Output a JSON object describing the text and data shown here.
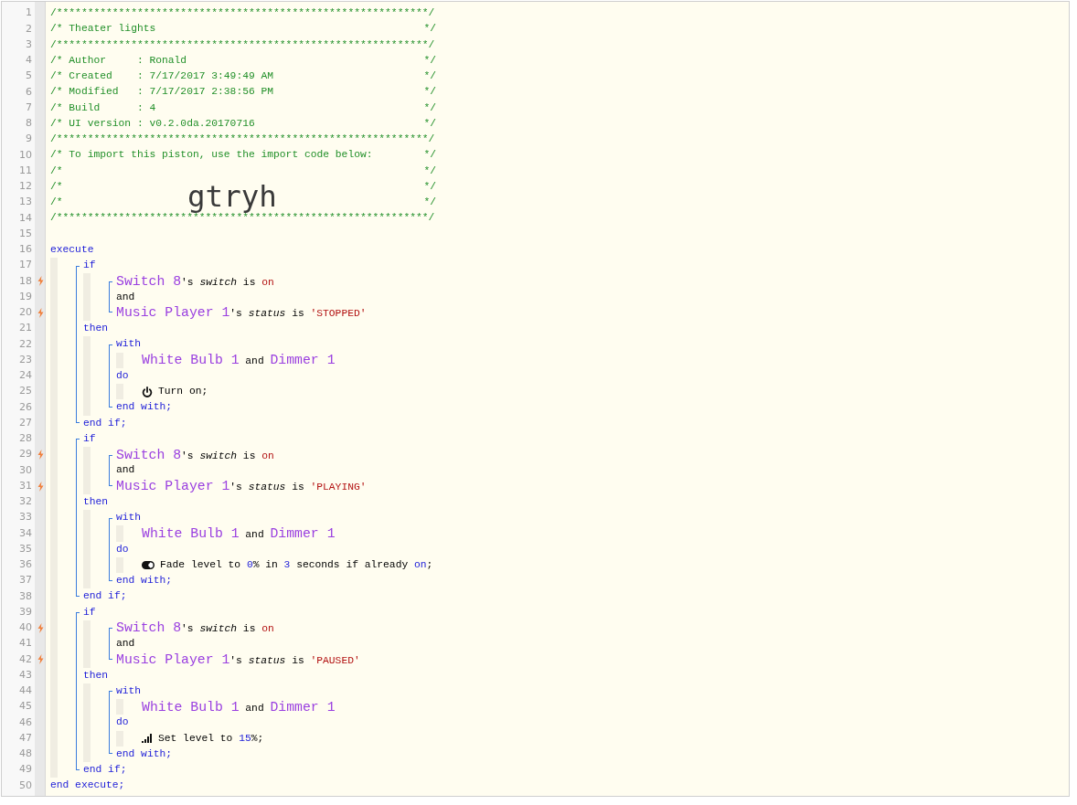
{
  "import_code": "gtryh",
  "lines": [
    {
      "kind": "line",
      "line": "1",
      "tokens": [
        {
          "kind": "comment",
          "text": "/************************************************************/"
        }
      ]
    },
    {
      "kind": "line",
      "line": "2",
      "tokens": [
        {
          "kind": "comment",
          "text": "/* Theater lights"
        },
        {
          "kind": "comment_end",
          "text": "*/"
        }
      ]
    },
    {
      "kind": "line",
      "line": "3",
      "tokens": [
        {
          "kind": "comment",
          "text": "/************************************************************/"
        }
      ]
    },
    {
      "kind": "line",
      "line": "4",
      "tokens": [
        {
          "kind": "comment",
          "text": "/* Author     : Ronald"
        },
        {
          "kind": "comment_end",
          "text": "*/"
        }
      ]
    },
    {
      "kind": "line",
      "line": "5",
      "tokens": [
        {
          "kind": "comment",
          "text": "/* Created    : 7/17/2017 3:49:49 AM"
        },
        {
          "kind": "comment_end",
          "text": "*/"
        }
      ]
    },
    {
      "kind": "line",
      "line": "6",
      "tokens": [
        {
          "kind": "comment",
          "text": "/* Modified   : 7/17/2017 2:38:56 PM"
        },
        {
          "kind": "comment_end",
          "text": "*/"
        }
      ]
    },
    {
      "kind": "line",
      "line": "7",
      "tokens": [
        {
          "kind": "comment",
          "text": "/* Build      : 4"
        },
        {
          "kind": "comment_end",
          "text": "*/"
        }
      ]
    },
    {
      "kind": "line",
      "line": "8",
      "tokens": [
        {
          "kind": "comment",
          "text": "/* UI version : v0.2.0da.20170716"
        },
        {
          "kind": "comment_end",
          "text": "*/"
        }
      ]
    },
    {
      "kind": "line",
      "line": "9",
      "tokens": [
        {
          "kind": "comment",
          "text": "/************************************************************/"
        }
      ]
    },
    {
      "kind": "line",
      "line": "10",
      "tokens": [
        {
          "kind": "comment",
          "text": "/* To import this piston, use the import code below:"
        },
        {
          "kind": "comment_end",
          "text": "*/"
        }
      ]
    },
    {
      "kind": "line",
      "line": "11",
      "tokens": [
        {
          "kind": "comment",
          "text": "/*"
        },
        {
          "kind": "comment_end",
          "text": "*/"
        }
      ]
    },
    {
      "kind": "line",
      "line": "12",
      "tokens": [
        {
          "kind": "comment",
          "text": "/*"
        },
        {
          "kind": "comment_end",
          "text": "*/"
        }
      ]
    },
    {
      "kind": "line",
      "line": "13",
      "tokens": [
        {
          "kind": "comment",
          "text": "/*"
        },
        {
          "kind": "comment_end",
          "text": "*/"
        }
      ]
    },
    {
      "kind": "line",
      "line": "14",
      "tokens": [
        {
          "kind": "comment",
          "text": "/************************************************************/"
        }
      ]
    },
    {
      "kind": "line",
      "line": "15"
    },
    {
      "kind": "line",
      "line": "16",
      "tokens": [
        {
          "kind": "kw",
          "text": "execute"
        }
      ],
      "children": [
        {
          "kind": "group",
          "items": [
            {
              "kind": "line",
              "line": "17",
              "tokens": [
                {
                  "kind": "kw",
                  "text": "if"
                }
              ],
              "children": [
                {
                  "kind": "group",
                  "items": [
                    {
                      "kind": "line",
                      "line": "18",
                      "trigger": true,
                      "tokens": [
                        {
                          "kind": "dev",
                          "text": "Switch 8"
                        },
                        {
                          "kind": "txt",
                          "text": "'s "
                        },
                        {
                          "kind": "attr",
                          "text": "switch"
                        },
                        {
                          "kind": "txt",
                          "text": " is "
                        },
                        {
                          "kind": "val",
                          "text": "on"
                        }
                      ]
                    },
                    {
                      "kind": "line",
                      "line": "19",
                      "trigger": false,
                      "tokens": [
                        {
                          "kind": "txt",
                          "text": "and"
                        }
                      ]
                    },
                    {
                      "kind": "line",
                      "line": "20",
                      "trigger": true,
                      "tokens": [
                        {
                          "kind": "dev",
                          "text": "Music Player 1"
                        },
                        {
                          "kind": "txt",
                          "text": "'s "
                        },
                        {
                          "kind": "attr",
                          "text": "status"
                        },
                        {
                          "kind": "txt",
                          "text": " is "
                        },
                        {
                          "kind": "val",
                          "text": "'STOPPED'"
                        }
                      ]
                    }
                  ]
                }
              ]
            },
            {
              "kind": "line",
              "line": "21",
              "tokens": [
                {
                  "kind": "kw",
                  "text": "then"
                }
              ],
              "children": [
                {
                  "kind": "group",
                  "items": [
                    {
                      "kind": "line",
                      "line": "22",
                      "tokens": [
                        {
                          "kind": "kw",
                          "text": "with"
                        }
                      ],
                      "children": [
                        {
                          "kind": "line",
                          "line": "23",
                          "tokens": [
                            {
                              "kind": "dev",
                              "text": "White Bulb 1"
                            },
                            {
                              "kind": "txt",
                              "text": " and "
                            },
                            {
                              "kind": "dev",
                              "text": "Dimmer 1"
                            }
                          ]
                        }
                      ]
                    },
                    {
                      "kind": "line",
                      "line": "24",
                      "tokens": [
                        {
                          "kind": "kw",
                          "text": "do"
                        }
                      ],
                      "children": [
                        {
                          "kind": "line",
                          "line": "25",
                          "tokens": [
                            {
                              "kind": "power_icon"
                            },
                            {
                              "kind": "txt",
                              "text": "Turn on;"
                            }
                          ]
                        }
                      ]
                    },
                    {
                      "kind": "line",
                      "line": "26",
                      "tokens": [
                        {
                          "kind": "kw",
                          "text": "end with;"
                        }
                      ]
                    }
                  ]
                }
              ]
            },
            {
              "kind": "line",
              "line": "27",
              "tokens": [
                {
                  "kind": "kw",
                  "text": "end if;"
                }
              ]
            }
          ]
        },
        {
          "kind": "group",
          "items": [
            {
              "kind": "line",
              "line": "28",
              "tokens": [
                {
                  "kind": "kw",
                  "text": "if"
                }
              ],
              "children": [
                {
                  "kind": "group",
                  "items": [
                    {
                      "kind": "line",
                      "line": "29",
                      "trigger": true,
                      "tokens": [
                        {
                          "kind": "dev",
                          "text": "Switch 8"
                        },
                        {
                          "kind": "txt",
                          "text": "'s "
                        },
                        {
                          "kind": "attr",
                          "text": "switch"
                        },
                        {
                          "kind": "txt",
                          "text": " is "
                        },
                        {
                          "kind": "val",
                          "text": "on"
                        }
                      ]
                    },
                    {
                      "kind": "line",
                      "line": "30",
                      "trigger": false,
                      "tokens": [
                        {
                          "kind": "txt",
                          "text": "and"
                        }
                      ]
                    },
                    {
                      "kind": "line",
                      "line": "31",
                      "trigger": true,
                      "tokens": [
                        {
                          "kind": "dev",
                          "text": "Music Player 1"
                        },
                        {
                          "kind": "txt",
                          "text": "'s "
                        },
                        {
                          "kind": "attr",
                          "text": "status"
                        },
                        {
                          "kind": "txt",
                          "text": " is "
                        },
                        {
                          "kind": "val",
                          "text": "'PLAYING'"
                        }
                      ]
                    }
                  ]
                }
              ]
            },
            {
              "kind": "line",
              "line": "32",
              "tokens": [
                {
                  "kind": "kw",
                  "text": "then"
                }
              ],
              "children": [
                {
                  "kind": "group",
                  "items": [
                    {
                      "kind": "line",
                      "line": "33",
                      "tokens": [
                        {
                          "kind": "kw",
                          "text": "with"
                        }
                      ],
                      "children": [
                        {
                          "kind": "line",
                          "line": "34",
                          "tokens": [
                            {
                              "kind": "dev",
                              "text": "White Bulb 1"
                            },
                            {
                              "kind": "txt",
                              "text": " and "
                            },
                            {
                              "kind": "dev",
                              "text": "Dimmer 1"
                            }
                          ]
                        }
                      ]
                    },
                    {
                      "kind": "line",
                      "line": "35",
                      "tokens": [
                        {
                          "kind": "kw",
                          "text": "do"
                        }
                      ],
                      "children": [
                        {
                          "kind": "line",
                          "line": "36",
                          "tokens": [
                            {
                              "kind": "toggle_icon"
                            },
                            {
                              "kind": "txt",
                              "text": "Fade level to "
                            },
                            {
                              "kind": "lit",
                              "text": "0"
                            },
                            {
                              "kind": "txt",
                              "text": "% in "
                            },
                            {
                              "kind": "lit",
                              "text": "3"
                            },
                            {
                              "kind": "txt",
                              "text": " seconds if already "
                            },
                            {
                              "kind": "lit",
                              "text": "on"
                            },
                            {
                              "kind": "txt",
                              "text": ";"
                            }
                          ]
                        }
                      ]
                    },
                    {
                      "kind": "line",
                      "line": "37",
                      "tokens": [
                        {
                          "kind": "kw",
                          "text": "end with;"
                        }
                      ]
                    }
                  ]
                }
              ]
            },
            {
              "kind": "line",
              "line": "38",
              "tokens": [
                {
                  "kind": "kw",
                  "text": "end if;"
                }
              ]
            }
          ]
        },
        {
          "kind": "group",
          "items": [
            {
              "kind": "line",
              "line": "39",
              "tokens": [
                {
                  "kind": "kw",
                  "text": "if"
                }
              ],
              "children": [
                {
                  "kind": "group",
                  "items": [
                    {
                      "kind": "line",
                      "line": "40",
                      "trigger": true,
                      "tokens": [
                        {
                          "kind": "dev",
                          "text": "Switch 8"
                        },
                        {
                          "kind": "txt",
                          "text": "'s "
                        },
                        {
                          "kind": "attr",
                          "text": "switch"
                        },
                        {
                          "kind": "txt",
                          "text": " is "
                        },
                        {
                          "kind": "val",
                          "text": "on"
                        }
                      ]
                    },
                    {
                      "kind": "line",
                      "line": "41",
                      "trigger": false,
                      "tokens": [
                        {
                          "kind": "txt",
                          "text": "and"
                        }
                      ]
                    },
                    {
                      "kind": "line",
                      "line": "42",
                      "trigger": true,
                      "tokens": [
                        {
                          "kind": "dev",
                          "text": "Music Player 1"
                        },
                        {
                          "kind": "txt",
                          "text": "'s "
                        },
                        {
                          "kind": "attr",
                          "text": "status"
                        },
                        {
                          "kind": "txt",
                          "text": " is "
                        },
                        {
                          "kind": "val",
                          "text": "'PAUSED'"
                        }
                      ]
                    }
                  ]
                }
              ]
            },
            {
              "kind": "line",
              "line": "43",
              "tokens": [
                {
                  "kind": "kw",
                  "text": "then"
                }
              ],
              "children": [
                {
                  "kind": "group",
                  "items": [
                    {
                      "kind": "line",
                      "line": "44",
                      "tokens": [
                        {
                          "kind": "kw",
                          "text": "with"
                        }
                      ],
                      "children": [
                        {
                          "kind": "line",
                          "line": "45",
                          "tokens": [
                            {
                              "kind": "dev",
                              "text": "White Bulb 1"
                            },
                            {
                              "kind": "txt",
                              "text": " and "
                            },
                            {
                              "kind": "dev",
                              "text": "Dimmer 1"
                            }
                          ]
                        }
                      ]
                    },
                    {
                      "kind": "line",
                      "line": "46",
                      "tokens": [
                        {
                          "kind": "kw",
                          "text": "do"
                        }
                      ],
                      "children": [
                        {
                          "kind": "line",
                          "line": "47",
                          "tokens": [
                            {
                              "kind": "level_icon"
                            },
                            {
                              "kind": "txt",
                              "text": "Set level to "
                            },
                            {
                              "kind": "lit",
                              "text": "15"
                            },
                            {
                              "kind": "txt",
                              "text": "%;"
                            }
                          ]
                        }
                      ]
                    },
                    {
                      "kind": "line",
                      "line": "48",
                      "tokens": [
                        {
                          "kind": "kw",
                          "text": "end with;"
                        }
                      ]
                    }
                  ]
                }
              ]
            },
            {
              "kind": "line",
              "line": "49",
              "tokens": [
                {
                  "kind": "kw",
                  "text": "end if;"
                }
              ]
            }
          ]
        }
      ]
    },
    {
      "kind": "line",
      "line": "50",
      "tokens": [
        {
          "kind": "kw",
          "text": "end execute;"
        }
      ]
    }
  ]
}
